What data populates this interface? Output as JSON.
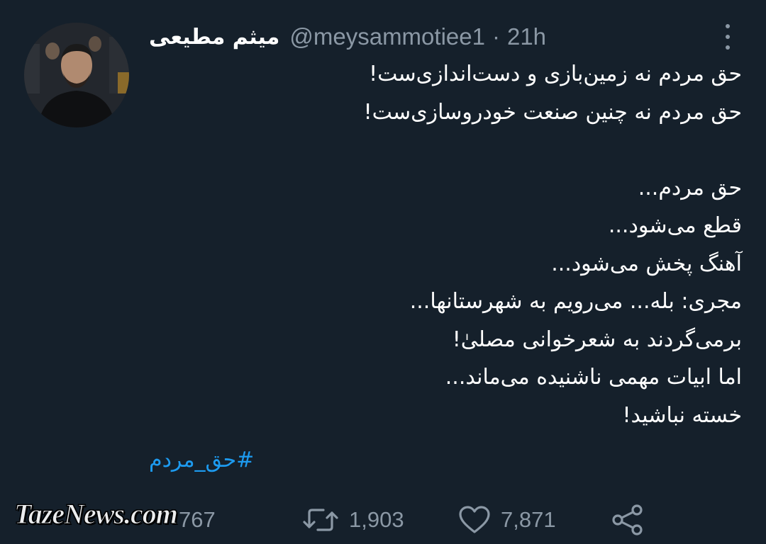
{
  "tweet": {
    "author": {
      "display_name": "میثم مطیعی",
      "handle": "@meysammotiee1",
      "separator": "·",
      "time": "21h"
    },
    "body_lines": [
      "حق مردم نه زمین‌بازی و دست‌اندازی‌ست!",
      "حق مردم نه چنین صنعت خودروسازی‌ست!",
      "",
      "حق مردم...",
      "قطع می‌شود...",
      "آهنگ پخش می‌شود...",
      "مجری: بله... می‌رویم به شهرستانها...",
      "برمی‌گردند به شعرخوانی مصلیٰ!",
      "اما ابیات مهمی ناشنیده می‌ماند...",
      "خسته نباشید!"
    ],
    "hashtag": "#حق_مردم",
    "stats": {
      "replies": "767",
      "retweets": "1,903",
      "likes": "7,871"
    }
  },
  "watermark": "TazeNews.com",
  "icons": {
    "more": "more-vertical-icon",
    "reply": "reply-icon",
    "retweet": "retweet-icon",
    "like": "heart-icon",
    "share": "share-icon"
  },
  "colors": {
    "background": "#15202b",
    "text_primary": "#ffffff",
    "text_secondary": "#8b98a5",
    "link": "#1d9bf0"
  }
}
